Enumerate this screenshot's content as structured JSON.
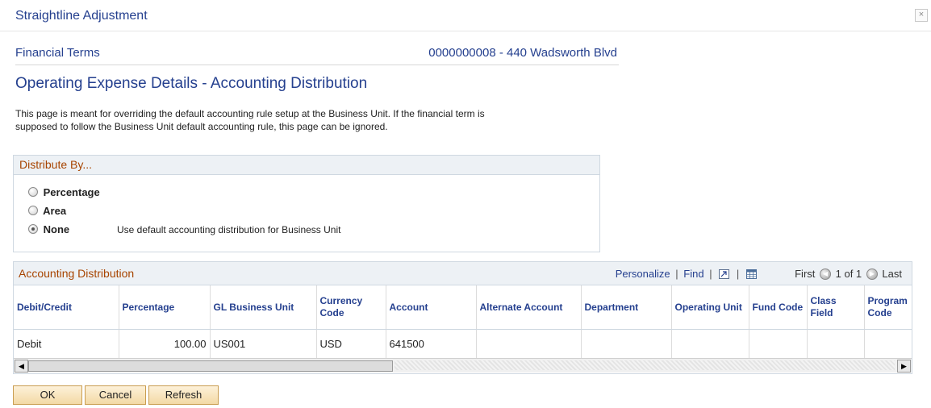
{
  "window": {
    "title": "Straightline Adjustment",
    "close_glyph": "×"
  },
  "header": {
    "left": "Financial Terms",
    "right": "0000000008 - 440 Wadsworth Blvd"
  },
  "page_title": "Operating Expense Details - Accounting Distribution",
  "intro_text": "This page is meant for overriding the default accounting rule setup at the Business Unit. If the financial term is supposed to follow the Business Unit default accounting rule, this page can be ignored.",
  "distribute_by": {
    "title": "Distribute By...",
    "options": [
      {
        "label": "Percentage",
        "checked": false
      },
      {
        "label": "Area",
        "checked": false
      },
      {
        "label": "None",
        "checked": true
      }
    ],
    "none_description": "Use default accounting distribution for Business Unit"
  },
  "grid": {
    "title": "Accounting Distribution",
    "personalize": "Personalize",
    "find": "Find",
    "separator": "|",
    "first": "First",
    "page_info": "1 of 1",
    "last": "Last",
    "columns": [
      "Debit/Credit",
      "Percentage",
      "GL Business Unit",
      "Currency Code",
      "Account",
      "Alternate Account",
      "Department",
      "Operating Unit",
      "Fund Code",
      "Class Field",
      "Program Code"
    ],
    "rows": [
      [
        "Debit",
        "100.00",
        "US001",
        "USD",
        "641500",
        "",
        "",
        "",
        "",
        "",
        ""
      ]
    ]
  },
  "buttons": {
    "ok": "OK",
    "cancel": "Cancel",
    "refresh": "Refresh"
  },
  "colors": {
    "link_blue": "#25408f",
    "section_orange": "#a74400",
    "header_bg": "#edf1f5",
    "button_bg": "#f3d9a5"
  },
  "icons": [
    "close-icon",
    "zoom-icon",
    "download-grid-icon",
    "previous-arrow-icon",
    "next-arrow-icon",
    "scroll-left-icon",
    "scroll-right-icon"
  ]
}
